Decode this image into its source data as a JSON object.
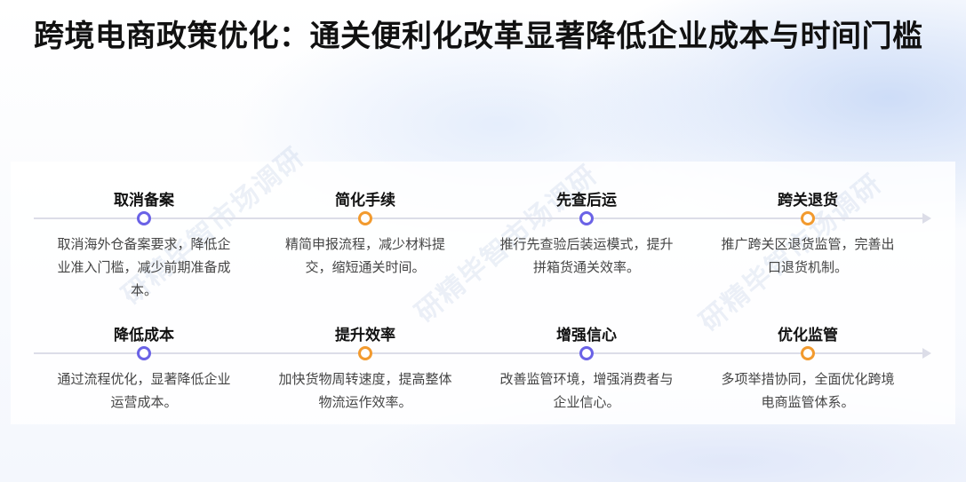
{
  "title": "跨境电商政策优化：通关便利化改革显著降低企业成本与时间门槛",
  "rows": [
    [
      {
        "heading": "取消备案",
        "desc": "取消海外仓备案要求，降低企业准入门槛，减少前期准备成本。",
        "dot": "#6a62e6"
      },
      {
        "heading": "简化手续",
        "desc": "精简申报流程，减少材料提交，缩短通关时间。",
        "dot": "#f29a2e"
      },
      {
        "heading": "先查后运",
        "desc": "推行先查验后装运模式，提升拼箱货通关效率。",
        "dot": "#6a62e6"
      },
      {
        "heading": "跨关退货",
        "desc": "推广跨关区退货监管，完善出口退货机制。",
        "dot": "#f29a2e"
      }
    ],
    [
      {
        "heading": "降低成本",
        "desc": "通过流程优化，显著降低企业运营成本。",
        "dot": "#6a62e6"
      },
      {
        "heading": "提升效率",
        "desc": "加快货物周转速度，提高整体物流运作效率。",
        "dot": "#f29a2e"
      },
      {
        "heading": "增强信心",
        "desc": "改善监管环境，增强消费者与企业信心。",
        "dot": "#6a62e6"
      },
      {
        "heading": "优化监管",
        "desc": "多项举措协同，全面优化跨境电商监管体系。",
        "dot": "#f29a2e"
      }
    ]
  ],
  "watermark": "研精毕智市场调研"
}
